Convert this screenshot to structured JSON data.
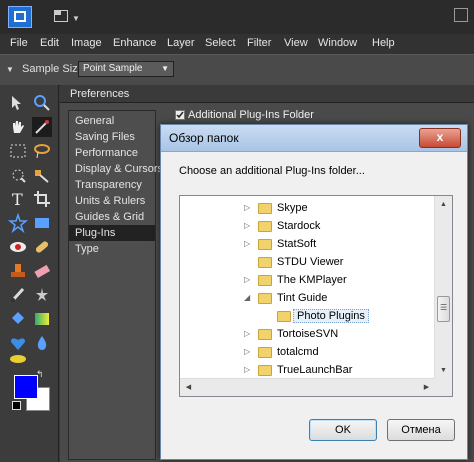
{
  "menubar": [
    "File",
    "Edit",
    "Image",
    "Enhance",
    "Layer",
    "Select",
    "Filter",
    "View",
    "Window",
    "Help"
  ],
  "options": {
    "sample_size_label": "Sample Size:",
    "sample_size_value": "Point Sample"
  },
  "colors": {
    "foreground": "#0000ff",
    "background": "#ffffff",
    "dialog_title_bg": "#b9d1ee",
    "close_button": "#c84a32"
  },
  "tools": [
    "move-icon",
    "zoom-icon",
    "hand-icon",
    "eyedropper-icon",
    "marquee-icon",
    "lasso-icon",
    "quick-selection-icon",
    "magic-wand-icon",
    "type-icon",
    "crop-icon",
    "cookie-cutter-icon",
    "straighten-icon",
    "red-eye-icon",
    "healing-brush-icon",
    "clone-stamp-icon",
    "eraser-icon",
    "brush-icon",
    "smart-brush-icon",
    "paint-bucket-icon",
    "gradient-icon",
    "shape-icon",
    "blur-icon",
    "sponge-icon",
    "pencil-icon"
  ],
  "preferences": {
    "title": "Preferences",
    "categories": [
      "General",
      "Saving Files",
      "Performance",
      "Display & Cursors",
      "Transparency",
      "Units & Rulers",
      "Guides & Grid",
      "Plug-Ins",
      "Type"
    ],
    "selected": "Plug-Ins",
    "additional_plugins_label": "Additional Plug-Ins Folder"
  },
  "dialog": {
    "title": "Обзор папок",
    "prompt": "Choose an additional Plug-Ins folder...",
    "close_label": "x",
    "folders": [
      {
        "name": "Skype",
        "expanded": false
      },
      {
        "name": "Stardock",
        "expanded": false
      },
      {
        "name": "StatSoft",
        "expanded": false
      },
      {
        "name": "STDU Viewer",
        "expanded": null
      },
      {
        "name": "The KMPlayer",
        "expanded": false
      },
      {
        "name": "Tint Guide",
        "expanded": true
      },
      {
        "name": "Photo Plugins",
        "expanded": null,
        "selected": true,
        "indent": 1
      },
      {
        "name": "TortoiseSVN",
        "expanded": false
      },
      {
        "name": "totalcmd",
        "expanded": false
      },
      {
        "name": "TrueLaunchBar",
        "expanded": false
      }
    ],
    "ok_label": "OK",
    "cancel_label": "Отмена"
  }
}
